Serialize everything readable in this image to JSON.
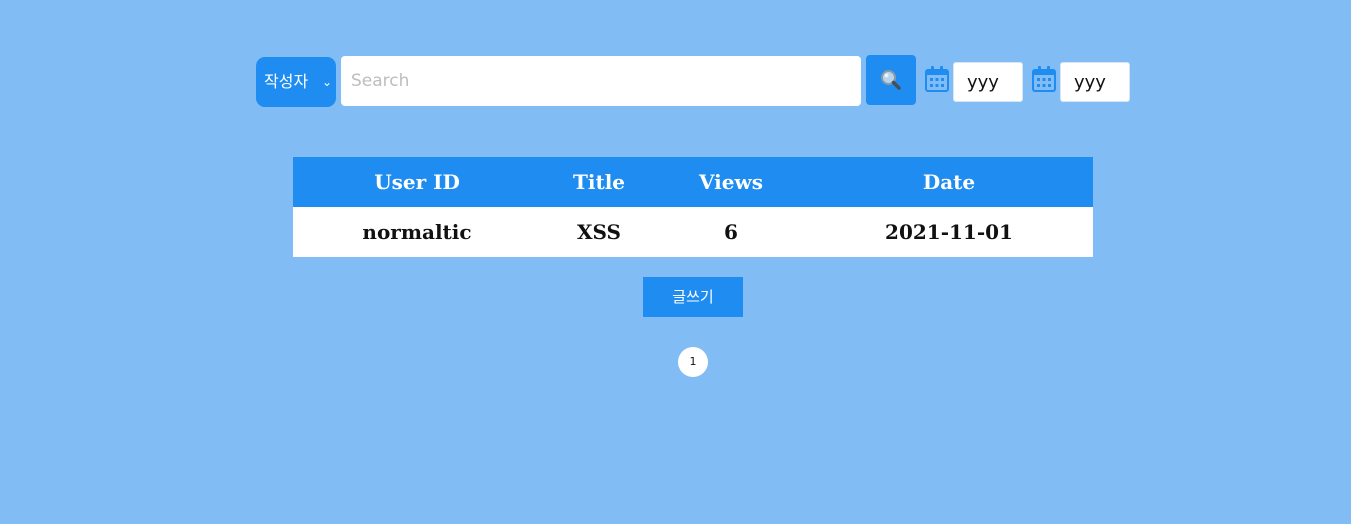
{
  "search": {
    "field_select": {
      "selected": "작성자",
      "icon": "chevron-down-icon"
    },
    "placeholder": "Search",
    "value": "",
    "button_icon": "search-icon",
    "date_from": {
      "icon": "calendar-icon",
      "value": "yyy"
    },
    "date_to": {
      "icon": "calendar-icon",
      "value": "yyy"
    }
  },
  "table": {
    "headers": [
      "User ID",
      "Title",
      "Views",
      "Date"
    ],
    "rows": [
      [
        "normaltic",
        "XSS",
        "6",
        "2021-11-01"
      ]
    ]
  },
  "write_button_label": "글쓰기",
  "pagination": {
    "pages": [
      "1"
    ],
    "current": "1"
  },
  "colors": {
    "background": "#82bcf5",
    "accent": "#1e8cf0",
    "surface": "#ffffff"
  }
}
